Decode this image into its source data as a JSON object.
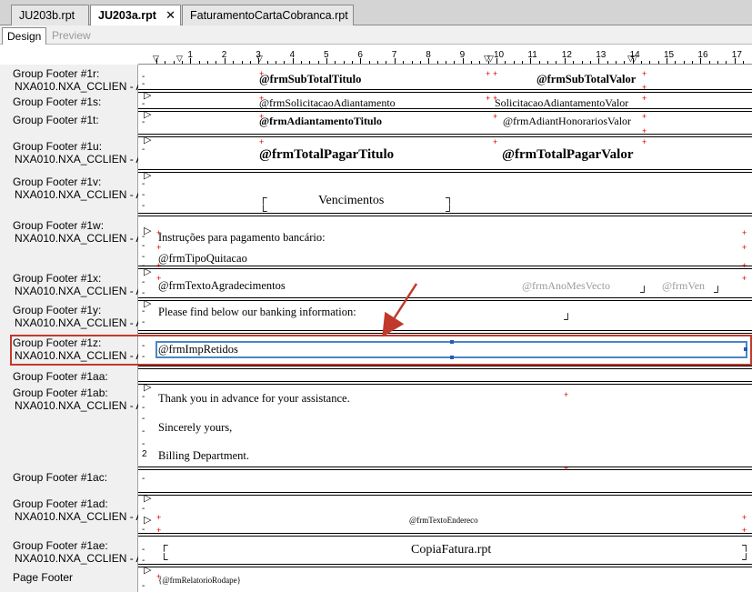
{
  "doc_tabs": [
    {
      "label": "JU203b.rpt",
      "active": false
    },
    {
      "label": "JU203a.rpt",
      "active": true
    },
    {
      "label": "FaturamentoCartaCobranca.rpt",
      "active": false
    }
  ],
  "close_glyph": "✕",
  "view_tabs": [
    {
      "label": "Design",
      "active": true
    },
    {
      "label": "Preview",
      "active": false
    }
  ],
  "ruler": {
    "numbers": [
      "1",
      "2",
      "3",
      "4",
      "5",
      "6",
      "7",
      "8",
      "9",
      "10",
      "11",
      "12",
      "13",
      "14",
      "15",
      "16",
      "17"
    ],
    "marker_glyph": "▽"
  },
  "sections": [
    {
      "name": "Group Footer #1r:",
      "sub": "NXA010.NXA_CCLIEN - A"
    },
    {
      "name": "Group Footer #1s:",
      "sub": ""
    },
    {
      "name": "Group Footer #1t:",
      "sub": ""
    },
    {
      "name": "Group Footer #1u:",
      "sub": "NXA010.NXA_CCLIEN - A"
    },
    {
      "name": "Group Footer #1v:",
      "sub": "NXA010.NXA_CCLIEN - A"
    },
    {
      "name": "Group Footer #1w:",
      "sub": "NXA010.NXA_CCLIEN - A"
    },
    {
      "name": "Group Footer #1x:",
      "sub": "NXA010.NXA_CCLIEN - A"
    },
    {
      "name": "Group Footer #1y:",
      "sub": "NXA010.NXA_CCLIEN - A"
    },
    {
      "name": "Group Footer #1z:",
      "sub": "NXA010.NXA_CCLIEN - A"
    },
    {
      "name": "Group Footer #1aa:",
      "sub": ""
    },
    {
      "name": "Group Footer #1ab:",
      "sub": "NXA010.NXA_CCLIEN - A"
    },
    {
      "name": "Group Footer #1ac:",
      "sub": ""
    },
    {
      "name": "Group Footer #1ad:",
      "sub": "NXA010.NXA_CCLIEN - A"
    },
    {
      "name": "Group Footer #1ae:",
      "sub": "NXA010.NXA_CCLIEN - A"
    },
    {
      "name": "Page Footer",
      "sub": ""
    }
  ],
  "fields": {
    "subtotal_titulo": "@frmSubTotalTitulo",
    "subtotal_valor": "@frmSubTotalValor",
    "solicitacao": "@frmSolicitacaoAdiantamento",
    "solicitacao_valor": "SolicitacaoAdiantamentoValor",
    "adiantamento_titulo": "@frmAdiantamentoTitulo",
    "adiant_honorarios": "@frmAdiantHonorariosValor",
    "total_pagar_titulo": "@frmTotalPagarTitulo",
    "total_pagar_valor": "@frmTotalPagarValor",
    "vencimentos": "Vencimentos",
    "instrucoes": "Instruções para pagamento bancário:",
    "tipo_quitacao": "@frmTipoQuitacao",
    "texto_agradecimentos": "@frmTextoAgradecimentos",
    "ano_mes_vecto": "@frmAnoMesVecto",
    "ven": "@frmVen",
    "please_find": "Please find below our banking information:",
    "imp_retidos": "@frmImpRetidos",
    "thank_you": "Thank you in advance for your assistance.",
    "sincerely": "Sincerely yours,",
    "billing": "Billing Department.",
    "texto_endereco": "@frmTextoEndereco",
    "copia_fatura": "CopiaFatura.rpt",
    "relatorio_rodape": "{@frmRelatorioRodape}"
  },
  "guide_marks": {
    "arrow": "▷",
    "dash": "-",
    "two": "2"
  },
  "colors": {
    "highlight": "#c0392b",
    "selection": "#4a86c8",
    "annotation_arrow": "#c0392b",
    "cross": "#e00000"
  }
}
